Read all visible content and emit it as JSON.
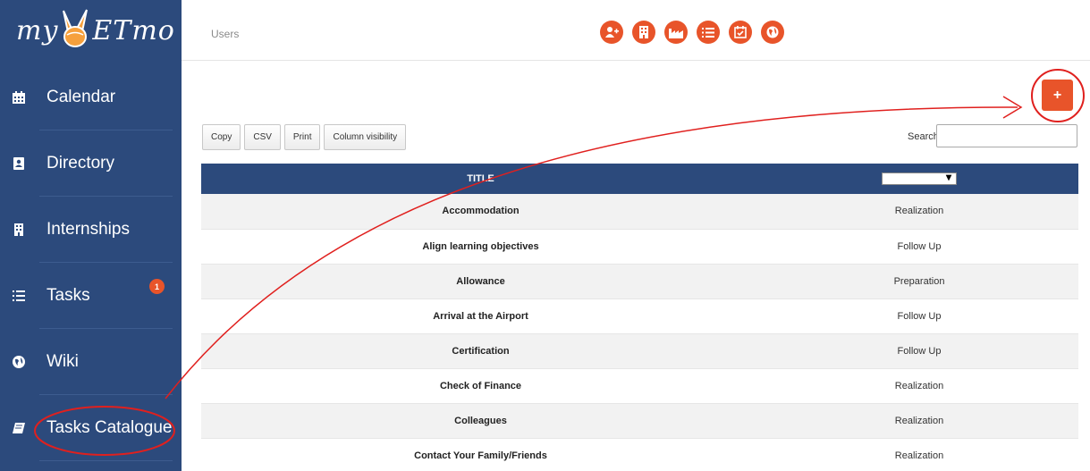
{
  "logo": {
    "prefix": "my",
    "suffix": "ETmo"
  },
  "sidebar": {
    "items": [
      {
        "label": "Calendar",
        "icon": "calendar-icon"
      },
      {
        "label": "Directory",
        "icon": "address-book-icon"
      },
      {
        "label": "Internships",
        "icon": "building-icon"
      },
      {
        "label": "Tasks",
        "icon": "list-icon",
        "badge": "1"
      },
      {
        "label": "Wiki",
        "icon": "globe-icon"
      },
      {
        "label": "Tasks Catalogue",
        "icon": "book-icon"
      }
    ]
  },
  "header": {
    "breadcrumb": "Users",
    "icons": [
      "add-user-icon",
      "building-icon",
      "factory-icon",
      "list-icon",
      "calendar-check-icon",
      "globe-icon"
    ]
  },
  "toolbar": {
    "add_label": "+",
    "buttons": [
      "Copy",
      "CSV",
      "Print",
      "Column visibility"
    ],
    "search_label": "Search:",
    "search_value": ""
  },
  "table": {
    "columns": [
      "TITLE",
      ""
    ],
    "rows": [
      {
        "title": "Accommodation",
        "phase": "Realization"
      },
      {
        "title": "Align learning objectives",
        "phase": "Follow Up"
      },
      {
        "title": "Allowance",
        "phase": "Preparation"
      },
      {
        "title": "Arrival at the Airport",
        "phase": "Follow Up"
      },
      {
        "title": "Certification",
        "phase": "Follow Up"
      },
      {
        "title": "Check of Finance",
        "phase": "Realization"
      },
      {
        "title": "Colleagues",
        "phase": "Realization"
      },
      {
        "title": "Contact Your Family/Friends",
        "phase": "Realization"
      }
    ]
  },
  "colors": {
    "sidebar": "#2c4a7c",
    "accent": "#e8542a",
    "annotation": "#e0201e"
  }
}
